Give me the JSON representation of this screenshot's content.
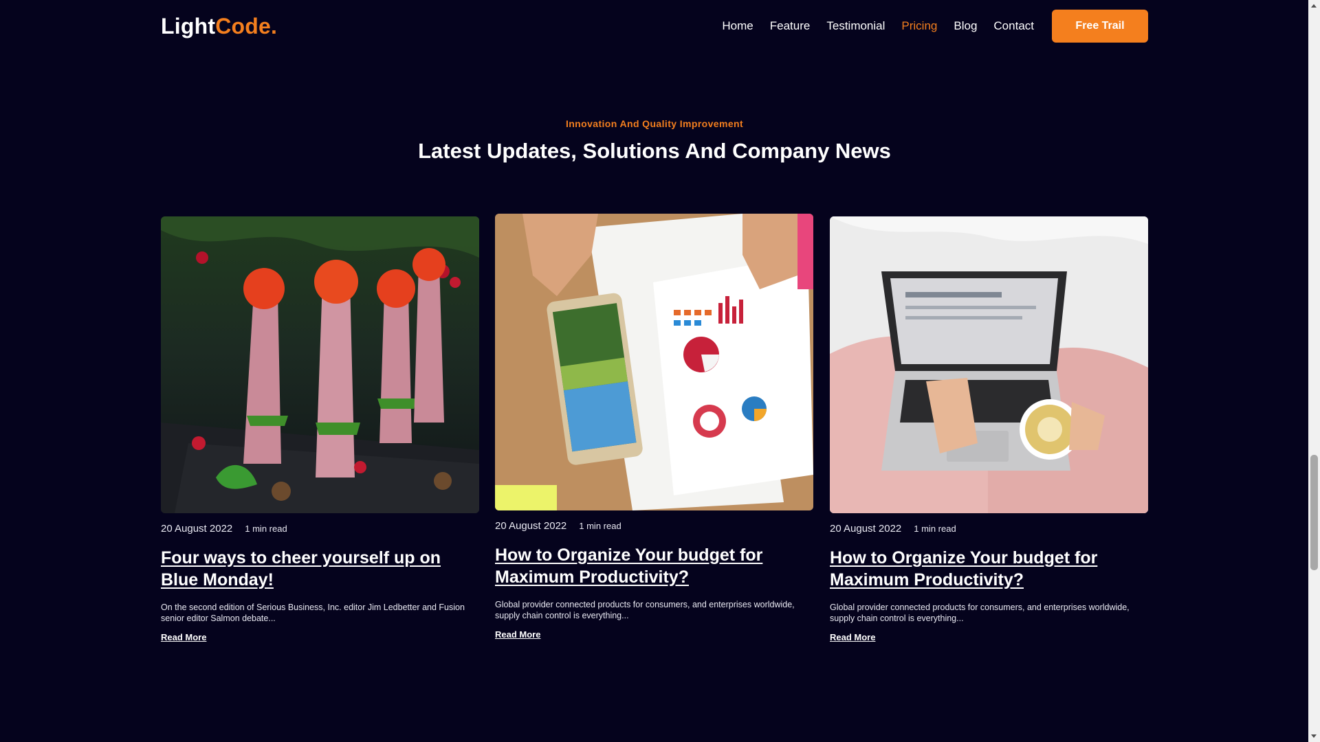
{
  "brand": {
    "name_main": "Light",
    "name_accent": "Code."
  },
  "nav": {
    "links": [
      {
        "label": "Home",
        "active": false
      },
      {
        "label": "Feature",
        "active": false
      },
      {
        "label": "Testimonial",
        "active": false
      },
      {
        "label": "Pricing",
        "active": true
      },
      {
        "label": "Blog",
        "active": false
      },
      {
        "label": "Contact",
        "active": false
      }
    ],
    "cta_label": "Free Trail"
  },
  "section": {
    "eyebrow": "Innovation And Quality Improvement",
    "title": "Latest Updates, Solutions And Company News"
  },
  "posts": [
    {
      "image": "festive-ham-rolls-photo",
      "date": "20 August 2022",
      "read_time": "1 min read",
      "title": "Four ways to cheer yourself up on Blue Monday!",
      "excerpt": "On the second edition of Serious Business, Inc. editor Jim Ledbetter and Fusion senior editor Salmon debate...",
      "link": "Read More"
    },
    {
      "image": "phone-and-charts-desk-photo",
      "date": "20 August 2022",
      "read_time": "1 min read",
      "title": "How to Organize Your budget for Maximum Productivity?",
      "excerpt": "Global provider connected products for consumers, and enterprises worldwide, supply chain control is everything...",
      "link": "Read More"
    },
    {
      "image": "laptop-and-latte-photo",
      "date": "20 August 2022",
      "read_time": "1 min read",
      "title": "How to Organize Your budget for Maximum Productivity?",
      "excerpt": "Global provider connected products for consumers, and enterprises worldwide, supply chain control is everything...",
      "link": "Read More"
    }
  ],
  "colors": {
    "background": "#05031d",
    "accent": "#f47f1e",
    "text": "#ffffff"
  }
}
